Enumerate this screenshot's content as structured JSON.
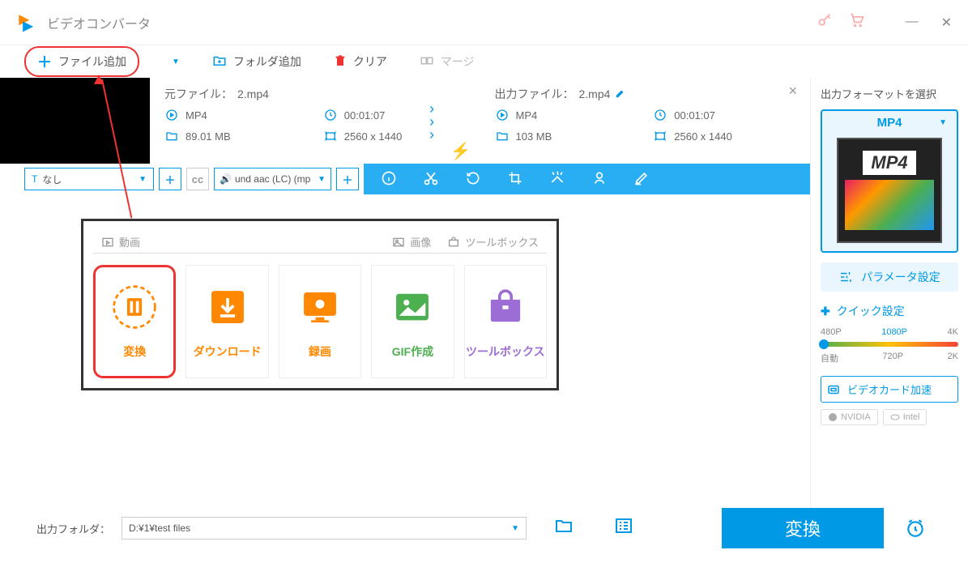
{
  "app": {
    "title": "ビデオコンバータ"
  },
  "toolbar": {
    "add_file": "ファイル追加",
    "add_folder": "フォルダ追加",
    "clear": "クリア",
    "merge": "マージ"
  },
  "source": {
    "label": "元ファイル：",
    "filename": "2.mp4",
    "format": "MP4",
    "duration": "00:01:07",
    "size": "89.01 MB",
    "resolution": "2560 x 1440"
  },
  "output": {
    "label": "出力ファイル：",
    "filename": "2.mp4",
    "format": "MP4",
    "duration": "00:01:07",
    "size": "103 MB",
    "resolution": "2560 x 1440"
  },
  "actionbar": {
    "subtitle_none": "なし",
    "audio_track": "und aac (LC) (mp"
  },
  "modules": {
    "tab_video": "動画",
    "tab_image": "画像",
    "tab_toolbox": "ツールボックス",
    "cards": [
      {
        "label": "変換",
        "color": "orange"
      },
      {
        "label": "ダウンロード",
        "color": "orange"
      },
      {
        "label": "録画",
        "color": "orange"
      },
      {
        "label": "GIF作成",
        "color": "green"
      },
      {
        "label": "ツールボックス",
        "color": "purple"
      }
    ]
  },
  "sidebar": {
    "title": "出力フォーマットを選択",
    "format": "MP4",
    "thumb_label": "MP4",
    "param_settings": "パラメータ設定",
    "quick_settings": "クイック設定",
    "presets_top": [
      "480P",
      "1080P",
      "4K"
    ],
    "presets_bottom": [
      "自動",
      "720P",
      "2K"
    ],
    "gpu_accel": "ビデオカード加速",
    "gpu_chips": [
      "NVIDIA",
      "Intel"
    ]
  },
  "footer": {
    "label": "出力フォルダ：",
    "path": "D:¥1¥test files",
    "convert": "変換"
  }
}
